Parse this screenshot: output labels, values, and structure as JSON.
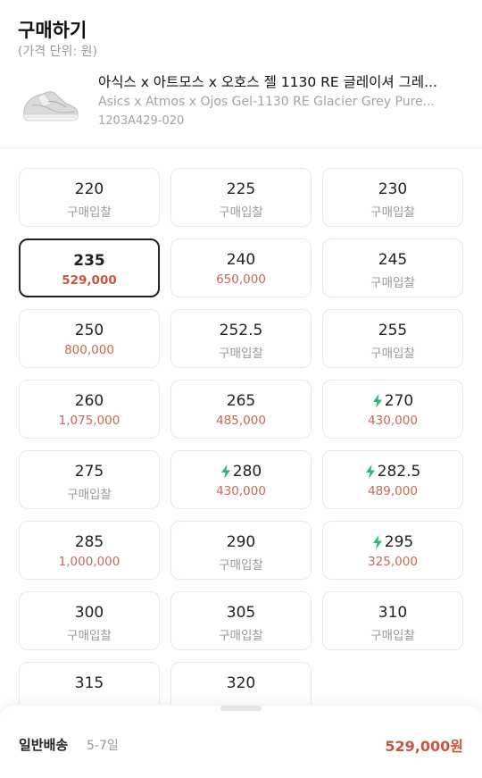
{
  "header": {
    "title": "구매하기",
    "subtitle": "(가격 단위: 원)"
  },
  "product": {
    "name_ko": "아식스 x 아트모스 x 오호스 젤 1130 RE 글레이셔 그레...",
    "name_en": "Asics x Atmos x Ojos Gel-1130 RE Glacier Grey Pure...",
    "model": "1203A429-020",
    "image_icon": "sneaker-image"
  },
  "colors": {
    "price": "#c56a52",
    "selected_border": "#222222",
    "bolt": "#2bb673"
  },
  "sizes": [
    {
      "size": "220",
      "sub": "구매입찰",
      "has_price": false,
      "fast": false,
      "selected": false
    },
    {
      "size": "225",
      "sub": "구매입찰",
      "has_price": false,
      "fast": false,
      "selected": false
    },
    {
      "size": "230",
      "sub": "구매입찰",
      "has_price": false,
      "fast": false,
      "selected": false
    },
    {
      "size": "235",
      "sub": "529,000",
      "has_price": true,
      "fast": false,
      "selected": true
    },
    {
      "size": "240",
      "sub": "650,000",
      "has_price": true,
      "fast": false,
      "selected": false
    },
    {
      "size": "245",
      "sub": "구매입찰",
      "has_price": false,
      "fast": false,
      "selected": false
    },
    {
      "size": "250",
      "sub": "800,000",
      "has_price": true,
      "fast": false,
      "selected": false
    },
    {
      "size": "252.5",
      "sub": "구매입찰",
      "has_price": false,
      "fast": false,
      "selected": false
    },
    {
      "size": "255",
      "sub": "구매입찰",
      "has_price": false,
      "fast": false,
      "selected": false
    },
    {
      "size": "260",
      "sub": "1,075,000",
      "has_price": true,
      "fast": false,
      "selected": false
    },
    {
      "size": "265",
      "sub": "485,000",
      "has_price": true,
      "fast": false,
      "selected": false
    },
    {
      "size": "270",
      "sub": "430,000",
      "has_price": true,
      "fast": true,
      "selected": false
    },
    {
      "size": "275",
      "sub": "구매입찰",
      "has_price": false,
      "fast": false,
      "selected": false
    },
    {
      "size": "280",
      "sub": "430,000",
      "has_price": true,
      "fast": true,
      "selected": false
    },
    {
      "size": "282.5",
      "sub": "489,000",
      "has_price": true,
      "fast": true,
      "selected": false
    },
    {
      "size": "285",
      "sub": "1,000,000",
      "has_price": true,
      "fast": false,
      "selected": false
    },
    {
      "size": "290",
      "sub": "구매입찰",
      "has_price": false,
      "fast": false,
      "selected": false
    },
    {
      "size": "295",
      "sub": "325,000",
      "has_price": true,
      "fast": true,
      "selected": false
    },
    {
      "size": "300",
      "sub": "구매입찰",
      "has_price": false,
      "fast": false,
      "selected": false
    },
    {
      "size": "305",
      "sub": "구매입찰",
      "has_price": false,
      "fast": false,
      "selected": false
    },
    {
      "size": "310",
      "sub": "구매입찰",
      "has_price": false,
      "fast": false,
      "selected": false
    },
    {
      "size": "315",
      "sub": "",
      "has_price": false,
      "fast": false,
      "selected": false
    },
    {
      "size": "320",
      "sub": "",
      "has_price": false,
      "fast": false,
      "selected": false
    }
  ],
  "bottom_bar": {
    "shipping_label": "일반배송",
    "shipping_days": "5-7일",
    "total_price": "529,000원"
  }
}
